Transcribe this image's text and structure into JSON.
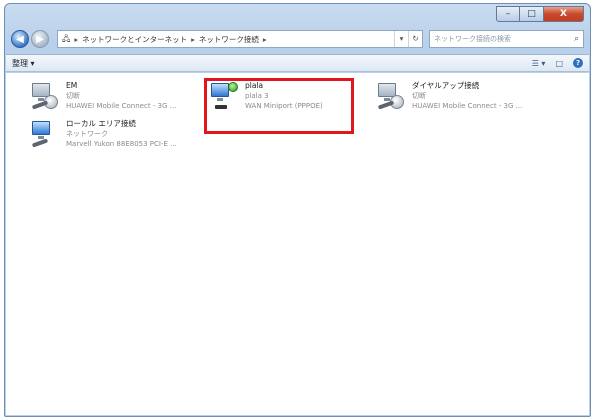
{
  "window": {
    "buttons": {
      "minimize": "–",
      "maximize": "□",
      "close": "X"
    }
  },
  "nav": {
    "back": "◀",
    "forward": "▶"
  },
  "address": {
    "crumbs": [
      "ネットワークとインターネット",
      "ネットワーク接続"
    ],
    "separator": "▸",
    "dropdown": "▾",
    "refresh": "↻"
  },
  "search": {
    "placeholder": "ネットワーク接続の検索"
  },
  "toolbar": {
    "organize": "整理 ▾",
    "view": "☰ ▾",
    "pane": "□",
    "help": "?"
  },
  "connections": [
    {
      "name": "EM",
      "status": "切断",
      "device": "HUAWEI Mobile Connect - 3G ..."
    },
    {
      "name": "plala",
      "status": "plala 3",
      "device": "WAN Miniport (PPPOE)"
    },
    {
      "name": "ダイヤルアップ接続",
      "status": "切断",
      "device": "HUAWEI Mobile Connect - 3G ..."
    },
    {
      "name": "ローカル エリア接続",
      "status": "ネットワーク",
      "device": "Marvell Yukon 88E8053 PCI-E ..."
    }
  ],
  "colors": {
    "highlight": "#e0161c",
    "frame": "#b9d0ea"
  }
}
